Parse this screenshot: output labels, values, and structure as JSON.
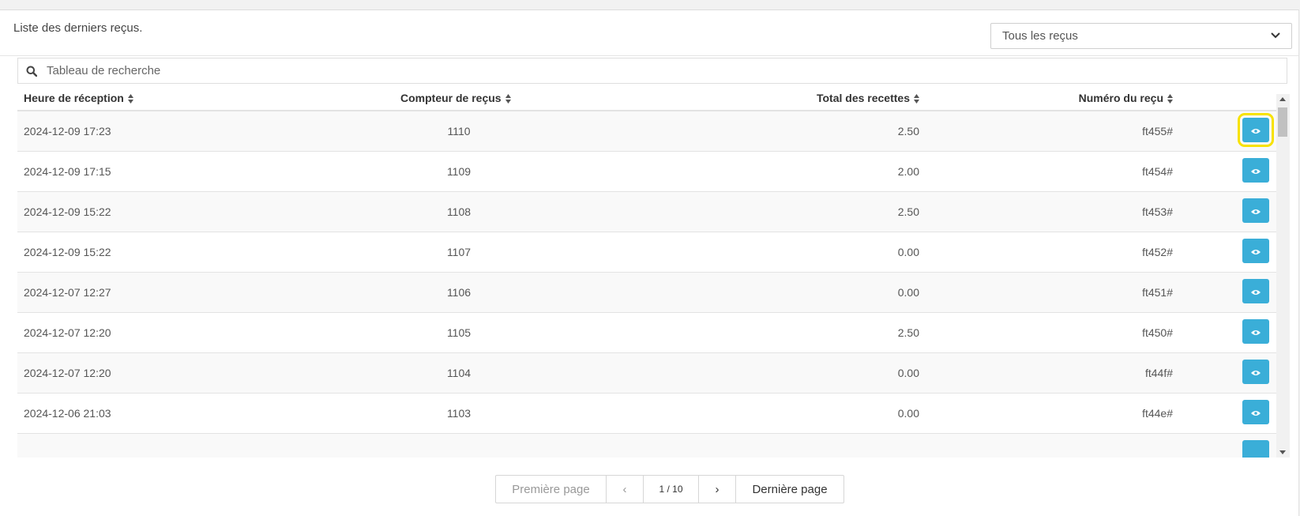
{
  "panel": {
    "title": "Liste des derniers reçus.",
    "filter": {
      "selected": "Tous les reçus"
    }
  },
  "search": {
    "placeholder": "Tableau de recherche"
  },
  "table": {
    "headers": [
      "Heure de réception",
      "Compteur de reçus",
      "Total des recettes",
      "Numéro du reçu"
    ],
    "rows": [
      {
        "time": "2024-12-09 17:23",
        "counter": "1110",
        "total": "2.50",
        "number": "ft455#"
      },
      {
        "time": "2024-12-09 17:15",
        "counter": "1109",
        "total": "2.00",
        "number": "ft454#"
      },
      {
        "time": "2024-12-09 15:22",
        "counter": "1108",
        "total": "2.50",
        "number": "ft453#"
      },
      {
        "time": "2024-12-09 15:22",
        "counter": "1107",
        "total": "0.00",
        "number": "ft452#"
      },
      {
        "time": "2024-12-07 12:27",
        "counter": "1106",
        "total": "0.00",
        "number": "ft451#"
      },
      {
        "time": "2024-12-07 12:20",
        "counter": "1105",
        "total": "2.50",
        "number": "ft450#"
      },
      {
        "time": "2024-12-07 12:20",
        "counter": "1104",
        "total": "0.00",
        "number": "ft44f#"
      },
      {
        "time": "2024-12-06 21:03",
        "counter": "1103",
        "total": "0.00",
        "number": "ft44e#"
      }
    ]
  },
  "pagination": {
    "first": "Première page",
    "prev": "‹",
    "page": "1 / 10",
    "next": "›",
    "last": "Dernière page"
  },
  "colors": {
    "view_button": "#3aaed8",
    "highlight": "#f7e200"
  },
  "icons": {
    "search": "search-icon",
    "view": "eye-icon",
    "sort": "sort-icon"
  }
}
